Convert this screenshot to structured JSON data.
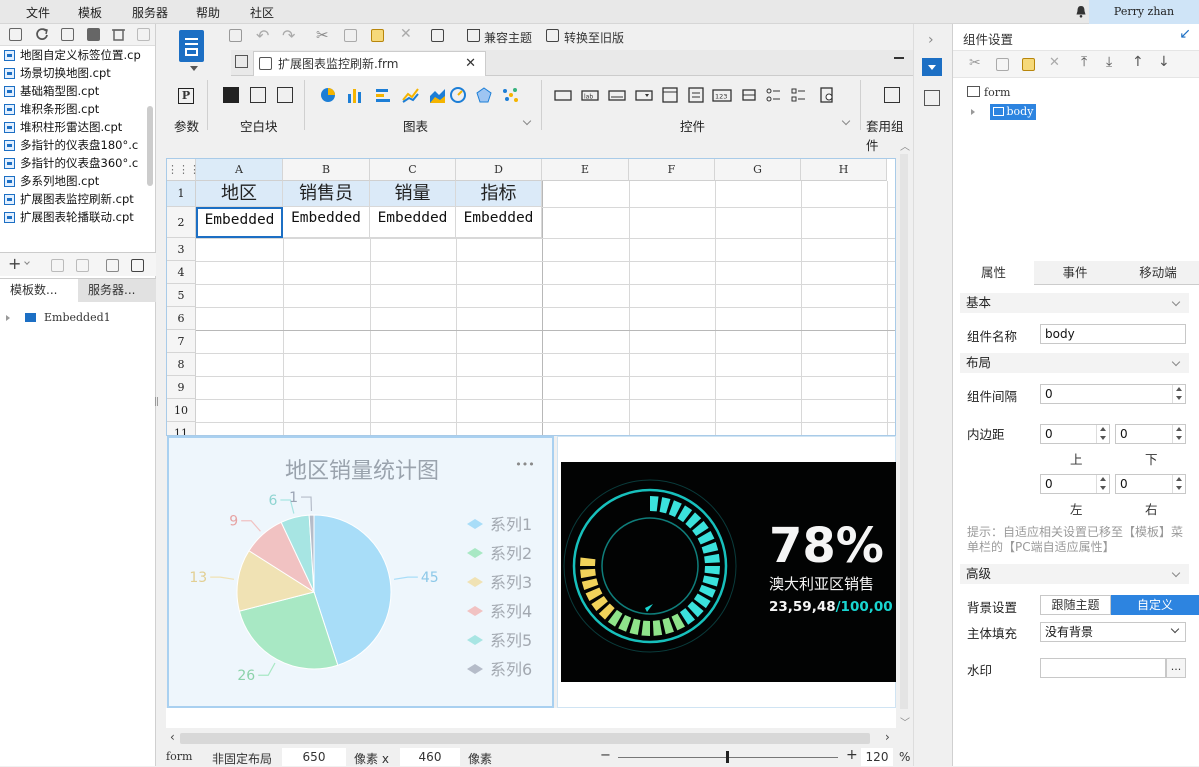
{
  "menu": {
    "file": "文件",
    "template": "模板",
    "server": "服务器",
    "help": "帮助",
    "community": "社区",
    "user": "Perry zhan"
  },
  "left": {
    "files": [
      "地图自定义标签位置.cp",
      "场景切换地图.cpt",
      "基础箱型图.cpt",
      "堆积条形图.cpt",
      "堆积柱形雷达图.cpt",
      "多指针的仪表盘180°.c",
      "多指针的仪表盘360°.c",
      "多系列地图.cpt",
      "扩展图表监控刷新.cpt",
      "扩展图表轮播联动.cpt"
    ],
    "tab_template_data": "模板数...",
    "tab_server": "服务器...",
    "tree_item": "Embedded1"
  },
  "toolbar": {
    "compat_theme": "兼容主题",
    "convert_old": "转换至旧版",
    "file_tab": "扩展图表监控刷新.frm"
  },
  "groups": {
    "param": "参数",
    "blank": "空白块",
    "chart": "图表",
    "widget": "控件",
    "apply": "套用组件"
  },
  "sheet": {
    "columns": [
      "A",
      "B",
      "C",
      "D",
      "E",
      "F",
      "G",
      "H"
    ],
    "rows": [
      "1",
      "2",
      "3",
      "4",
      "5",
      "6",
      "7",
      "8",
      "9",
      "10",
      "11"
    ],
    "header_cells": [
      "地区",
      "销售员",
      "销量",
      "指标"
    ],
    "embedded_cells": [
      "Embedded",
      "Embedded",
      "Embedded",
      "Embedded"
    ]
  },
  "pie": {
    "title": "地区销量统计图",
    "more": "•••",
    "legend": [
      "系列1",
      "系列2",
      "系列3",
      "系列4",
      "系列5",
      "系列6"
    ],
    "labels": [
      "45",
      "26",
      "13",
      "9",
      "6",
      "1"
    ]
  },
  "chart_data": {
    "type": "pie",
    "title": "地区销量统计图",
    "categories": [
      "系列1",
      "系列2",
      "系列3",
      "系列4",
      "系列5",
      "系列6"
    ],
    "values": [
      45,
      26,
      13,
      9,
      6,
      1
    ],
    "colors": [
      "#a8ddf8",
      "#a8e8c4",
      "#f0e2b4",
      "#f1c2c2",
      "#a7e5e3",
      "#b5bcc9"
    ],
    "legend": "right"
  },
  "gauge": {
    "percent": "78%",
    "text1": "澳大利亚区销售",
    "text2_a": "23,59,48",
    "text2_b": "/100,00"
  },
  "status": {
    "form": "form",
    "layout": "非固定布局",
    "width": "650",
    "px1": "像素 x",
    "height": "460",
    "px2": "像素",
    "zoom": "120",
    "zoom_unit": "%"
  },
  "right": {
    "title": "组件设置",
    "tree_form": "form",
    "tree_body": "body",
    "tabs": [
      "属性",
      "事件",
      "移动端"
    ],
    "basic": "基本",
    "comp_name_label": "组件名称",
    "comp_name_value": "body",
    "layout": "布局",
    "gap_label": "组件间隔",
    "gap_value": "0",
    "padding_label": "内边距",
    "pad_top": "0",
    "pad_bottom": "0",
    "pad_left": "0",
    "pad_right": "0",
    "top": "上",
    "bottom": "下",
    "leftl": "左",
    "rightl": "右",
    "hint": "提示：自适应相关设置已移至【模板】菜单栏的【PC端自适应属性】",
    "advanced": "高级",
    "bg_label": "背景设置",
    "bg_follow": "跟随主题",
    "bg_custom": "自定义",
    "fill_label": "主体填充",
    "fill_value": "没有背景",
    "watermark_label": "水印",
    "watermark_btn": "..."
  }
}
